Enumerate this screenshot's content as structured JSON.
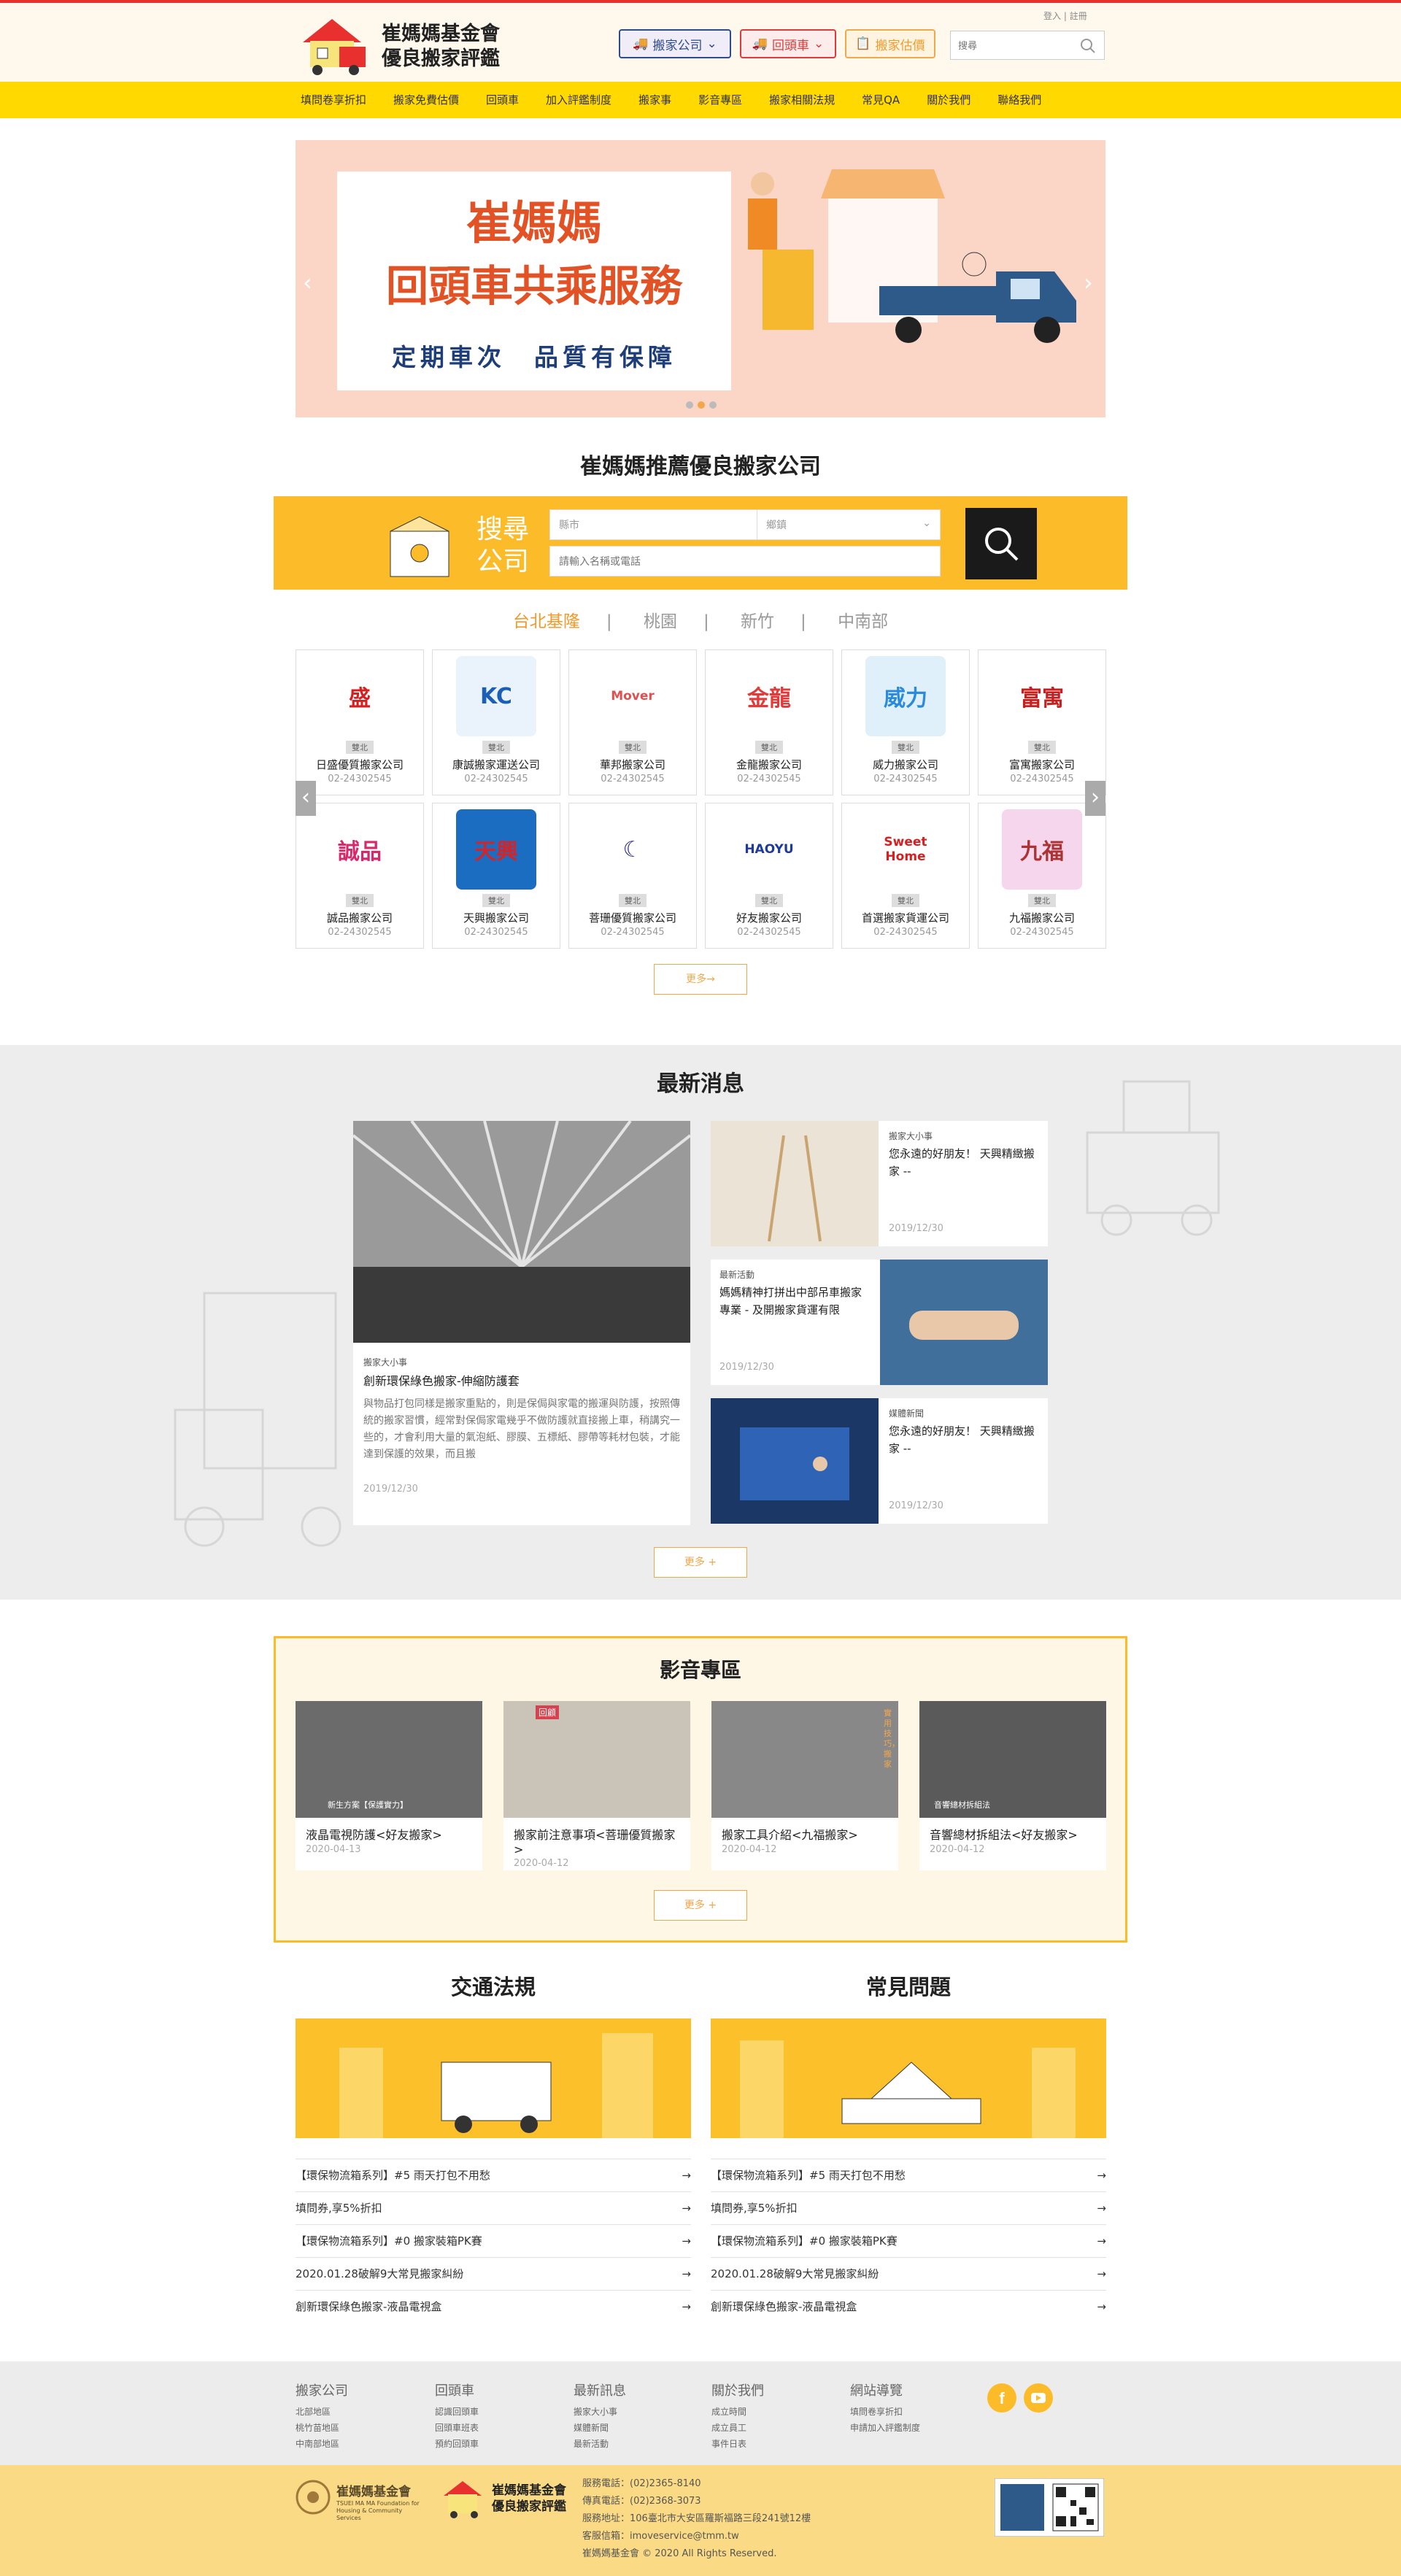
{
  "header": {
    "logo_line1": "崔媽媽基金會",
    "logo_line2": "優良搬家評鑑",
    "login": "登入",
    "register": "註冊",
    "btn_moving": "搬家公司",
    "btn_return": "回頭車",
    "btn_estimate": "搬家估價",
    "search_placeholder": "搜尋"
  },
  "nav": [
    "填問卷享折扣",
    "搬家免費估價",
    "回頭車",
    "加入評鑑制度",
    "搬家事",
    "影音專區",
    "搬家相關法規",
    "常見QA",
    "關於我們",
    "聯絡我們"
  ],
  "banner": {
    "title1": "崔媽媽",
    "title2": "回頭車共乘服務",
    "subtitle": "定期車次　品質有保障"
  },
  "recommend": {
    "title": "崔媽媽推薦優良搬家公司",
    "finder_label": "搜尋公司",
    "city_placeholder": "縣市",
    "district_placeholder": "鄉鎮",
    "keyword_placeholder": "請輸入名稱或電話",
    "tabs": [
      "台北基隆",
      "桃園",
      "新竹",
      "中南部"
    ],
    "separator": "|",
    "tag": "雙北",
    "companies": [
      {
        "name": "日盛優質搬家公司",
        "phone": "02-24302545",
        "logo": "盛",
        "color": "#d62020",
        "bg": "#fff"
      },
      {
        "name": "康誠搬家運送公司",
        "phone": "02-24302545",
        "logo": "KC",
        "color": "#1a5fb4",
        "bg": "#eaf2fb"
      },
      {
        "name": "華邦搬家公司",
        "phone": "02-24302545",
        "logo": "Mover",
        "color": "#e05050",
        "bg": "#fff"
      },
      {
        "name": "金龍搬家公司",
        "phone": "02-24302545",
        "logo": "金龍",
        "color": "#e03a3a",
        "bg": "#fff"
      },
      {
        "name": "威力搬家公司",
        "phone": "02-24302545",
        "logo": "威力",
        "color": "#2a8adb",
        "bg": "#dff0fb"
      },
      {
        "name": "富寓搬家公司",
        "phone": "02-24302545",
        "logo": "富寓",
        "color": "#c81e1e",
        "bg": "#fff"
      },
      {
        "name": "誠品搬家公司",
        "phone": "02-24302545",
        "logo": "誠品",
        "color": "#d6286b",
        "bg": "#fff"
      },
      {
        "name": "天興搬家公司",
        "phone": "02-24302545",
        "logo": "天興",
        "color": "#d2252a",
        "bg": "#1b6dc1"
      },
      {
        "name": "菩珊優質搬家公司",
        "phone": "02-24302545",
        "logo": "☾",
        "color": "#2a2a8a",
        "bg": "#fff"
      },
      {
        "name": "好友搬家公司",
        "phone": "02-24302545",
        "logo": "HAOYU",
        "color": "#1f3b9a",
        "bg": "#fff"
      },
      {
        "name": "首選搬家貨運公司",
        "phone": "02-24302545",
        "logo": "Sweet Home",
        "color": "#d62020",
        "bg": "#fff"
      },
      {
        "name": "九福搬家公司",
        "phone": "02-24302545",
        "logo": "九福",
        "color": "#a33",
        "bg": "#f6d6ec"
      }
    ],
    "more": "更多→"
  },
  "news": {
    "title": "最新消息",
    "main": {
      "cat": "搬家大小事",
      "title": "創新環保綠色搬家-伸縮防護套",
      "body": "與物品打包同樣是搬家重點的，則是保侷與家電的搬運與防護，按照傳統的搬家習慣，經常對保侷家電幾乎不做防護就直接搬上車，稍講究一些的，才會利用大量的氣泡紙、膠膜、五標紙、膠帶等耗材包裝，才能達到保護的效果，而且搬",
      "date": "2019/12/30"
    },
    "items": [
      {
        "cat": "搬家大小事",
        "title": "您永遠的好朋友！ 天興精緻搬家 --",
        "date": "2019/12/30"
      },
      {
        "cat": "最新活動",
        "title": "媽媽精神打拼出中部吊車搬家專業 - 及開搬家貨運有限",
        "date": "2019/12/30"
      },
      {
        "cat": "媒體新聞",
        "title": "您永遠的好朋友！ 天興精緻搬家 --",
        "date": "2019/12/30"
      }
    ],
    "more": "更多 +"
  },
  "video": {
    "title": "影音專區",
    "items": [
      {
        "title": "液晶電視防護<好友搬家>",
        "date": "2020-04-13",
        "caption": "新生方案【保護實力】"
      },
      {
        "title": "搬家前注意事項<菩珊優質搬家>",
        "date": "2020-04-12",
        "caption": "回顧"
      },
      {
        "title": "搬家工具介紹<九福搬家>",
        "date": "2020-04-12",
        "caption": "實用技巧，搬家"
      },
      {
        "title": "音響總材拆組法<好友搬家>",
        "date": "2020-04-12",
        "caption": "音響總材拆組法"
      }
    ],
    "more": "更多 +"
  },
  "law": {
    "title": "交通法規",
    "items": [
      "【環保物流箱系列】#5 雨天打包不用愁",
      "填問券,享5%折扣",
      "【環保物流箱系列】#0 搬家裝箱PK賽",
      "2020.01.28破解9大常見搬家糾紛",
      "創新環保綠色搬家-液晶電視盒"
    ]
  },
  "faq": {
    "title": "常見問題",
    "items": [
      "【環保物流箱系列】#5 雨天打包不用愁",
      "填問券,享5%折扣",
      "【環保物流箱系列】#0 搬家裝箱PK賽",
      "2020.01.28破解9大常見搬家糾紛",
      "創新環保綠色搬家-液晶電視盒"
    ]
  },
  "footer": {
    "cols": [
      {
        "title": "搬家公司",
        "links": [
          "北部地區",
          "桃竹苗地區",
          "中南部地區"
        ]
      },
      {
        "title": "回頭車",
        "links": [
          "認識回頭車",
          "回頭車班表",
          "預約回頭車"
        ]
      },
      {
        "title": "最新訊息",
        "links": [
          "搬家大小事",
          "媒體新聞",
          "最新活動"
        ]
      },
      {
        "title": "關於我們",
        "links": [
          "成立時間",
          "成立員工",
          "事件日表"
        ]
      },
      {
        "title": "網站導覽",
        "links": [
          "填問卷享折扣",
          "申請加入評鑑制度"
        ]
      }
    ],
    "org_name": "崔媽媽基金會",
    "org_en": "TSUEI MA MA Foundation for Housing & Community Services",
    "logo_line1": "崔媽媽基金會",
    "logo_line2": "優良搬家評鑑",
    "info": [
      "服務電話：(02)2365-8140",
      "傳真電話：(02)2368-3073",
      "服務地址：106臺北市大安區羅斯福路三段241號12樓",
      "客服信箱：imoveservice@tmm.tw",
      "崔媽媽基金會 © 2020 All Rights Reserved."
    ]
  },
  "colors": {
    "accent": "#fcbc2a",
    "nav": "#ffd900",
    "brand_red": "#e35225",
    "dark_blue": "#1d3e78"
  }
}
